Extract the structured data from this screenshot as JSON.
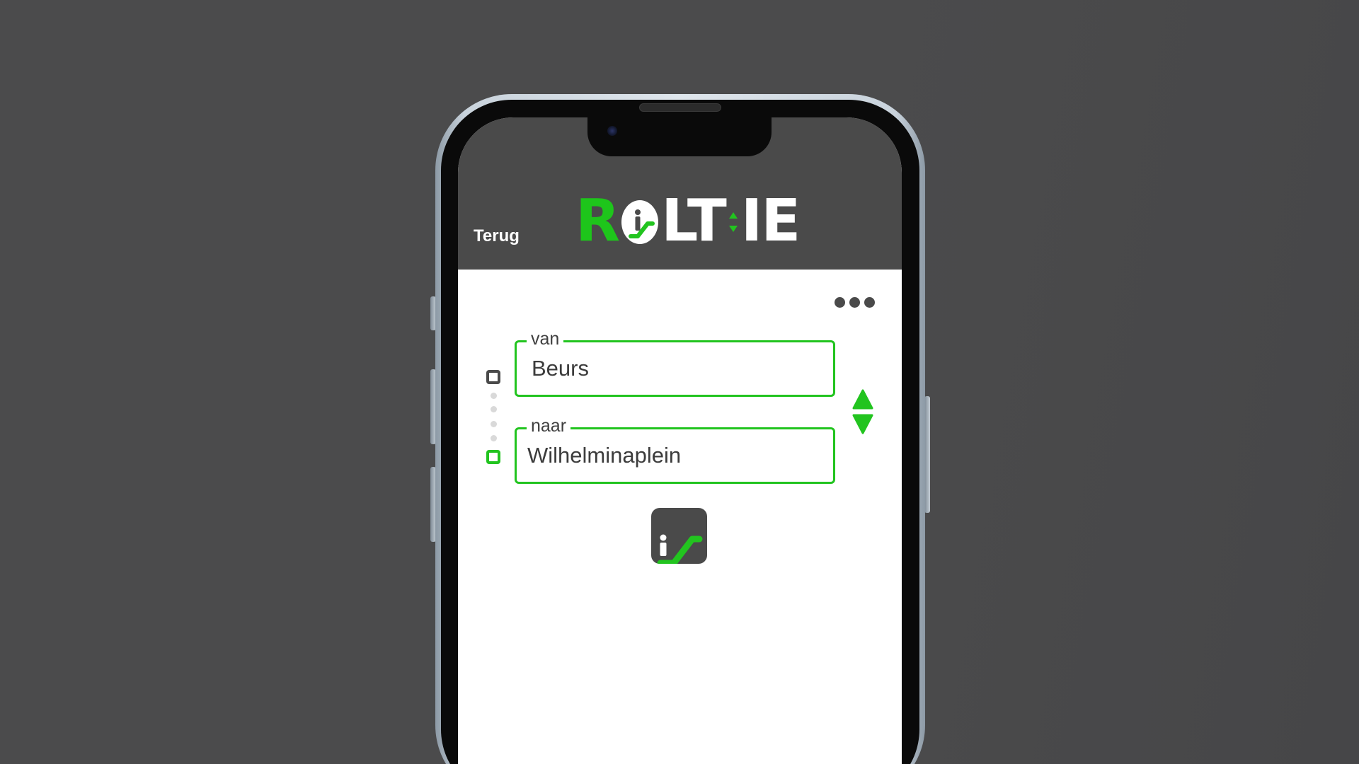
{
  "app": {
    "logo": {
      "letter_r": "R",
      "letters_lt": "LT",
      "letters_ie": "IE"
    },
    "header": {
      "back_label": "Terug"
    },
    "route": {
      "from": {
        "label": "van",
        "value": "Beurs"
      },
      "to": {
        "label": "naar",
        "value": "Wilhelminaplein"
      }
    },
    "icons": {
      "menu": "more-dots-icon",
      "swap": "swap-arrows-icon",
      "start": "route-start-icon",
      "end": "route-end-icon",
      "go": "escalator-icon"
    },
    "colors": {
      "brand_green": "#22c41f",
      "header_gray": "#4a4a4a",
      "background": "#4b4b4c"
    }
  }
}
